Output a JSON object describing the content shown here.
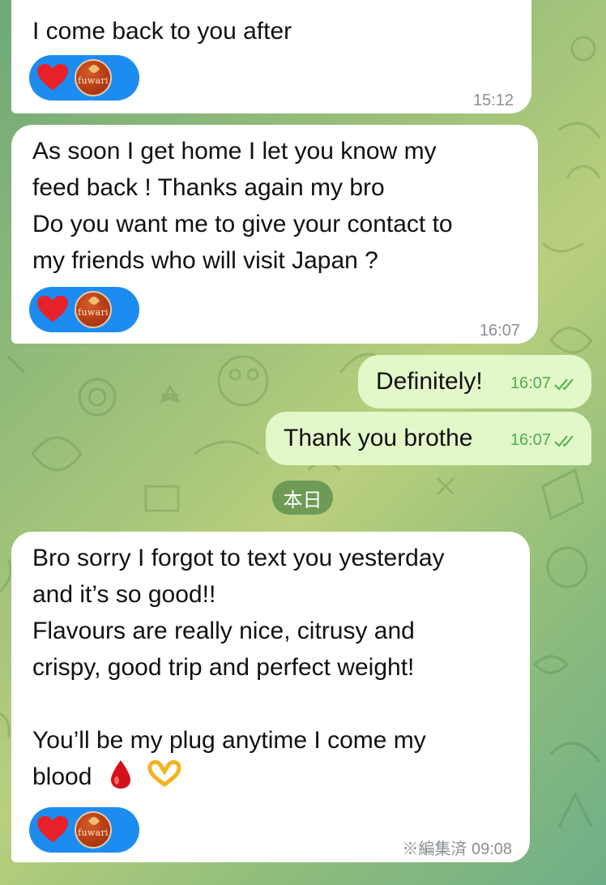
{
  "messages": [
    {
      "id": "m1",
      "direction": "incoming",
      "text": "I come back to you after",
      "time": "15:12",
      "reactions": [
        "heart",
        "fuwari-avatar"
      ]
    },
    {
      "id": "m2",
      "direction": "incoming",
      "text": "As soon I get home I let you know my\nfeed back ! Thanks again my bro\nDo you want me to give your contact to\nmy friends who will visit Japan ?",
      "time": "16:07",
      "reactions": [
        "heart",
        "fuwari-avatar"
      ]
    },
    {
      "id": "m3",
      "direction": "outgoing",
      "text": "Definitely!",
      "time": "16:07",
      "status": "read"
    },
    {
      "id": "m4",
      "direction": "outgoing",
      "text": "Thank you brothe",
      "time": "16:07",
      "status": "read"
    },
    {
      "id": "m5",
      "direction": "incoming",
      "text": "Bro sorry I forgot to text you yesterday\nand it’s so good!!\nFlavours are really nice, citrusy and\ncrispy, good trip and perfect weight!\n\nYou’ll be my plug anytime I come my\nblood",
      "time": "※編集済 09:08",
      "reactions": [
        "heart",
        "fuwari-avatar"
      ]
    }
  ],
  "date_separator": "本日",
  "reaction_avatar_label": "fuwari",
  "colors": {
    "reaction_bg": "#1d8cf0",
    "outgoing_bubble": "#e2f8c8",
    "incoming_bubble": "#ffffff",
    "read_check": "#4fae4e",
    "date_pill": "#6f9a55"
  },
  "icons": [
    "heart-icon",
    "double-check-icon",
    "blood-drop-icon",
    "heart-hands-icon"
  ]
}
